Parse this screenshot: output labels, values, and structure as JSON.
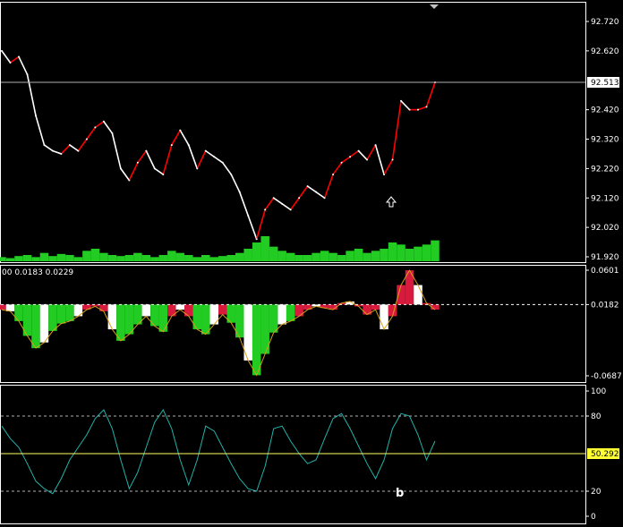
{
  "colors": {
    "background": "#000000",
    "frame": "#ffffff",
    "price_up": "#ff0000",
    "price_down": "#ffffff",
    "volume": "#22cc22",
    "hist_positive": "#d81b3c",
    "hist_negative": "#22cc22",
    "hist_highlight": "#ffffff",
    "hist_outline": "#d4a017",
    "oscillator_line": "#20b2aa",
    "level_line": "#b0b0b0",
    "current_level_line": "#ffff66",
    "current_price_box": "#ffffff",
    "current_osc_box": "#ffff33"
  },
  "panels": {
    "price": {
      "y_ticks": [
        "92.720",
        "92.620",
        "92.513",
        "92.420",
        "92.320",
        "92.220",
        "92.120",
        "92.020",
        "91.920"
      ],
      "current_price": "92.513",
      "arrow_icon": "up-arrow-icon"
    },
    "histogram": {
      "header": "00 0.0183 0.0229",
      "y_ticks": [
        "0.0601",
        "0.0182",
        "-0.0687"
      ]
    },
    "oscillator": {
      "y_ticks": [
        "100",
        "80",
        "20",
        "0"
      ],
      "current_value": "50.292",
      "annotation": "b"
    }
  },
  "chart_data": [
    {
      "type": "line",
      "series": [
        {
          "values": [
            92.62,
            92.58,
            92.6,
            92.54,
            92.4,
            92.3,
            92.28,
            92.27,
            92.3,
            92.28,
            92.32,
            92.36,
            92.38,
            92.34,
            92.22,
            92.18,
            92.24,
            92.28,
            92.22,
            92.2,
            92.3,
            92.35,
            92.3,
            92.22,
            92.28,
            92.26,
            92.24,
            92.2,
            92.14,
            92.06,
            91.98,
            92.08,
            92.12,
            92.1,
            92.08,
            92.12,
            92.16,
            92.14,
            92.12,
            92.2,
            92.24,
            92.26,
            92.28,
            92.25,
            92.3,
            92.2,
            92.25,
            92.45,
            92.42,
            92.42,
            92.43,
            92.513
          ]
        }
      ],
      "ylim": [
        91.92,
        92.77
      ],
      "grid": false
    },
    {
      "type": "bar",
      "title": "",
      "values": [
        2,
        1.5,
        2.5,
        3,
        2,
        4,
        2.5,
        3.5,
        3,
        2,
        5,
        6,
        4,
        3,
        2.5,
        3,
        4,
        3,
        2,
        3,
        5,
        4,
        3,
        2,
        3,
        2,
        2.5,
        3,
        4,
        6,
        9,
        12,
        7,
        5,
        4,
        3,
        3,
        4,
        5,
        4,
        3,
        5,
        6,
        4,
        5,
        6,
        9,
        8,
        6,
        7,
        8,
        10
      ],
      "grid": false
    },
    {
      "type": "area",
      "title": "",
      "series": [
        {
          "values": [
            0.012,
            0.01,
            -0.002,
            -0.02,
            -0.035,
            -0.028,
            -0.014,
            -0.005,
            -0.002,
            0.004,
            0.012,
            0.016,
            0.01,
            -0.012,
            -0.026,
            -0.018,
            -0.006,
            0.004,
            -0.008,
            -0.015,
            0.004,
            0.012,
            0.004,
            -0.012,
            -0.018,
            -0.006,
            0.006,
            -0.004,
            -0.022,
            -0.05,
            -0.068,
            -0.042,
            -0.016,
            -0.006,
            -0.002,
            0.004,
            0.012,
            0.016,
            0.014,
            0.012,
            0.02,
            0.022,
            0.016,
            0.006,
            0.012,
            -0.012,
            0.004,
            0.042,
            0.06,
            0.042,
            0.02,
            0.012
          ]
        }
      ],
      "ylim": [
        -0.0687,
        0.0601
      ],
      "grid": false
    },
    {
      "type": "line",
      "title": "",
      "series": [
        {
          "values": [
            72,
            62,
            55,
            42,
            28,
            22,
            18,
            30,
            45,
            55,
            65,
            78,
            85,
            70,
            45,
            22,
            35,
            55,
            75,
            85,
            70,
            45,
            25,
            45,
            72,
            68,
            55,
            42,
            30,
            22,
            20,
            40,
            70,
            72,
            60,
            50,
            42,
            45,
            62,
            78,
            82,
            70,
            56,
            42,
            30,
            45,
            70,
            82,
            80,
            65,
            45,
            60
          ]
        }
      ],
      "ylim": [
        0,
        100
      ],
      "grid": false
    }
  ]
}
